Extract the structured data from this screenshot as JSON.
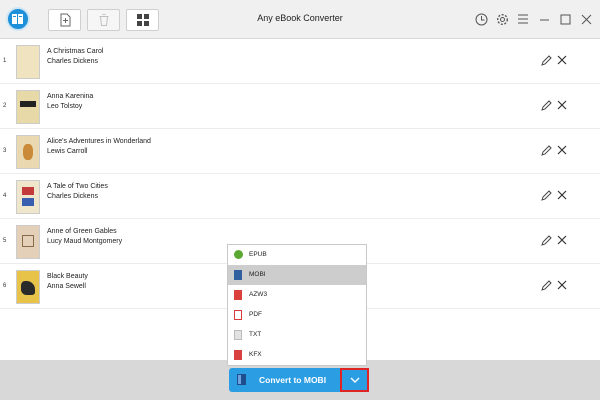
{
  "app": {
    "title": "Any eBook Converter"
  },
  "toolbar": {
    "add_icon": "add-file-icon",
    "delete_icon": "trash-icon",
    "view_icon": "grid-view-icon",
    "right_icons": [
      "history-icon",
      "gear-icon",
      "menu-icon",
      "minimize-icon",
      "maximize-icon",
      "close-icon"
    ]
  },
  "books": [
    {
      "num": "1",
      "title": "A Christmas Carol",
      "author": "Charles Dickens"
    },
    {
      "num": "2",
      "title": "Anna Karenina",
      "author": "Leo Tolstoy"
    },
    {
      "num": "3",
      "title": "Alice's Adventures in Wonderland",
      "author": "Lewis Carroll"
    },
    {
      "num": "4",
      "title": "A Tale of Two Cities",
      "author": "Charles Dickens"
    },
    {
      "num": "5",
      "title": "Anne of Green Gables",
      "author": "Lucy Maud Montgomery"
    },
    {
      "num": "6",
      "title": "Black Beauty",
      "author": "Anna Sewell"
    }
  ],
  "formats": [
    {
      "label": "EPUB",
      "color": "#5aa832",
      "selected": false
    },
    {
      "label": "MOBI",
      "color": "#2f5f9f",
      "selected": true
    },
    {
      "label": "AZW3",
      "color": "#d9413a",
      "selected": false
    },
    {
      "label": "PDF",
      "color": "#d93a3a",
      "selected": false
    },
    {
      "label": "TXT",
      "color": "#cfcfcf",
      "selected": false
    },
    {
      "label": "KFX",
      "color": "#d94040",
      "selected": false
    }
  ],
  "convert": {
    "label": "Convert to MOBI"
  },
  "colors": {
    "accent": "#2b9de3",
    "highlight": "#e02424"
  }
}
